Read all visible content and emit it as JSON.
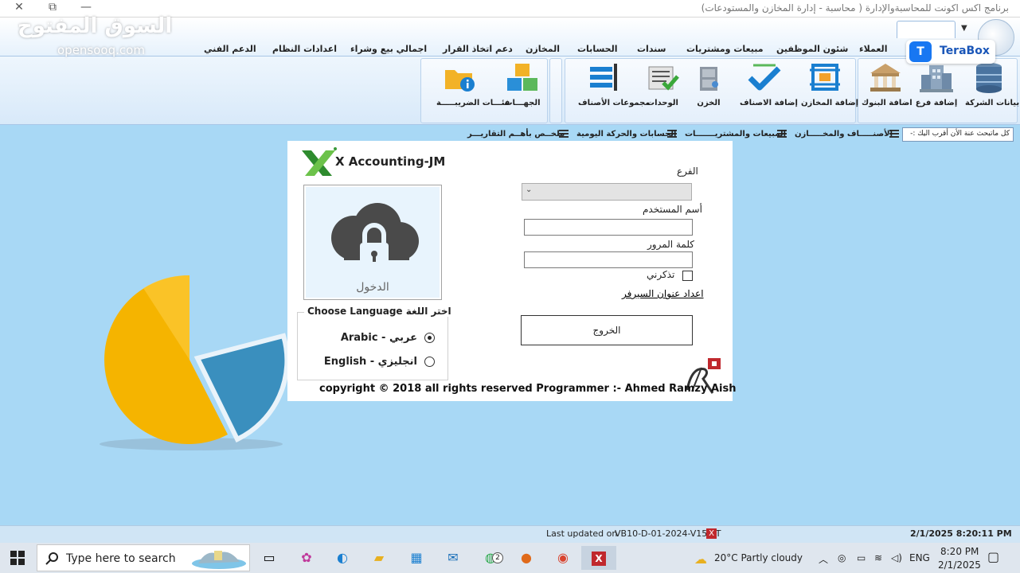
{
  "window": {
    "title": "برنامج اكس اكونت للمحاسبةوالإدارة ( محاسبة - إدارة المخازن والمستودعات)",
    "controls": {
      "minimize": "—",
      "restore": "⧉",
      "close": "✕"
    }
  },
  "watermark": {
    "main": "السوق المفتوح",
    "sub": "opensooq.com"
  },
  "terabox": {
    "label": "TeraBox"
  },
  "tabs": [
    {
      "label": "العملاء"
    },
    {
      "label": "شئون الموظفين"
    },
    {
      "label": "مبيعات ومشتريات"
    },
    {
      "label": "سندات"
    },
    {
      "label": "الحسابات"
    },
    {
      "label": "المخازن"
    },
    {
      "label": "دعم اتخاذ القرار"
    },
    {
      "label": "اجمالي بيع وشراء"
    },
    {
      "label": "اعدادات النظام"
    },
    {
      "label": "الدعم الفني"
    }
  ],
  "ribbon": {
    "buttons": [
      {
        "label": "بيانات الشركة",
        "icon": "server-icon"
      },
      {
        "label": "إضافة فرع",
        "icon": "branch-building-icon"
      },
      {
        "label": "اضافة البنوك",
        "icon": "bank-icon"
      },
      {
        "label": "إضافة المخازن",
        "icon": "warehouse-frame-icon"
      },
      {
        "label": "إضافة الاصناف",
        "icon": "checkmark-icon"
      },
      {
        "label": "الخزن",
        "icon": "safe-icon"
      },
      {
        "label": "الوحدات",
        "icon": "units-checklist-icon"
      },
      {
        "label": "مجموعات الأصناف",
        "icon": "item-groups-icon"
      },
      {
        "label": "الجهـــات",
        "icon": "entities-blocks-icon"
      },
      {
        "label": "فئـــات الضريبـــــة",
        "icon": "tax-folder-info-icon"
      }
    ]
  },
  "quickbar": {
    "search_text": "كل ماتبحث عنة الأن أقرب اليك :-",
    "items": [
      {
        "label": "الأصنـــــاف والمخـــــازن"
      },
      {
        "label": "المبيعات والمشتريـــــــات"
      },
      {
        "label": "الحسابات والحركة اليومية"
      },
      {
        "label": "ملخــص بأهــم التقاريـــر"
      }
    ]
  },
  "login": {
    "brand": "X Accounting-JM",
    "lock_label": "الدخول",
    "language_legend": "Choose Language اختر اللغة",
    "languages": [
      {
        "label": "Arabic - عربي",
        "selected": true
      },
      {
        "label": "English - انجليزي",
        "selected": false
      }
    ],
    "branch_label": "الفرع",
    "branch_value": "",
    "username_label": "أسم المستخدم",
    "username_value": "",
    "password_label": "كلمة المرور",
    "password_value": "",
    "remember_label": "تذكرني",
    "remember_checked": false,
    "server_link": "اعداد عنوان السيرفر",
    "exit_label": "الخروج",
    "copyright": "copyright © 2018 all rights reserved Programmer :- Ahmed Ramzy Aish"
  },
  "status": {
    "last_updated_label": "Last updated on",
    "version": "VB10-D-01-2024-V15.ST",
    "datetime": "2/1/2025 8:20:11 PM"
  },
  "taskbar": {
    "search_placeholder": "Type here to search",
    "whatsapp_badge": "2",
    "weather": "20°C  Partly cloudy",
    "language": "ENG",
    "time": "8:20 PM",
    "date": "2/1/2025"
  }
}
